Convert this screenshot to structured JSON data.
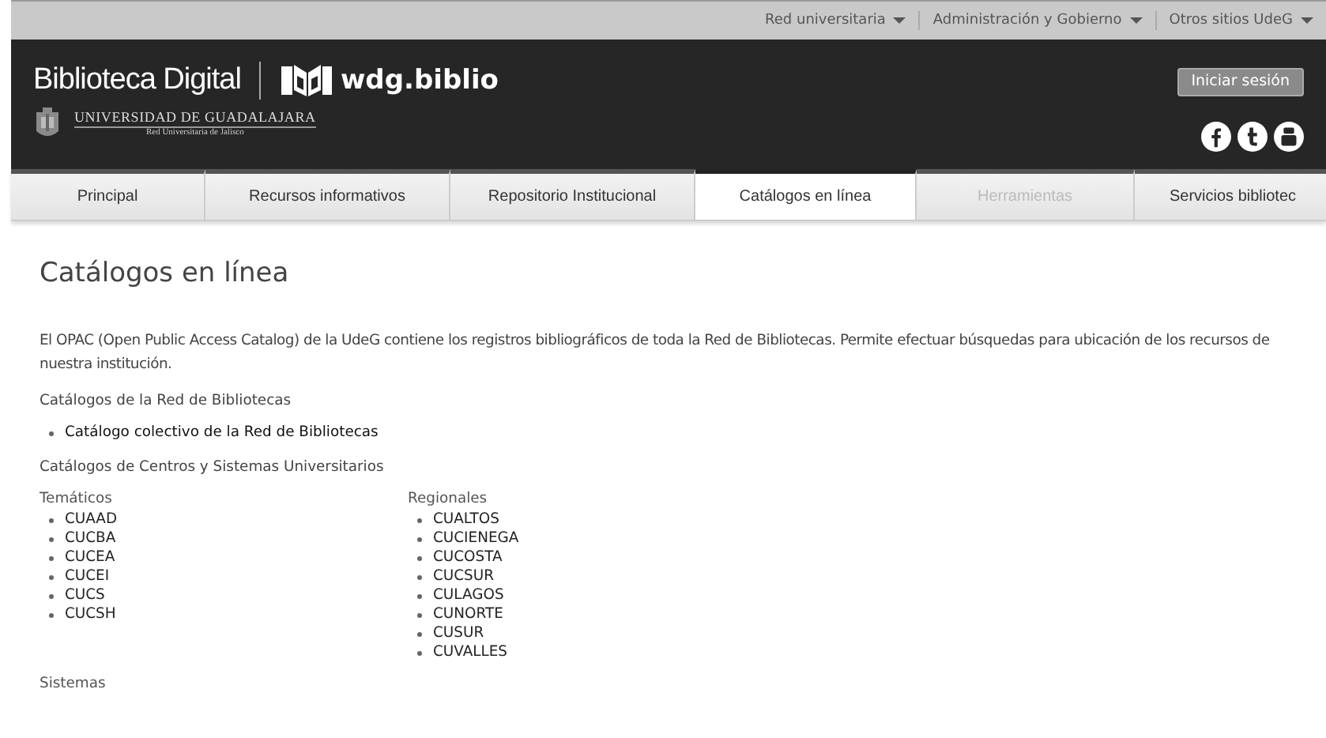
{
  "top_links": [
    {
      "label": "Red universitaria"
    },
    {
      "label": "Administración y Gobierno"
    },
    {
      "label": "Otros sitios UdeG"
    }
  ],
  "header": {
    "title": "Biblioteca Digital",
    "logo_text": "wdg.biblio",
    "university": "UNIVERSIDAD DE GUADALAJARA",
    "university_sub": "Red Universitaria de Jalisco",
    "login_button": "Iniciar sesión"
  },
  "nav": [
    {
      "label": "Principal",
      "selected": false,
      "disabled": false
    },
    {
      "label": "Recursos informativos",
      "selected": false,
      "disabled": false
    },
    {
      "label": "Repositorio Institucional",
      "selected": false,
      "disabled": false
    },
    {
      "label": "Catálogos en línea",
      "selected": true,
      "disabled": false
    },
    {
      "label": "Herramientas",
      "selected": false,
      "disabled": true
    },
    {
      "label": "Servicios bibliotec",
      "selected": false,
      "disabled": false
    }
  ],
  "page": {
    "title": "Catálogos en línea",
    "intro": "El OPAC (Open Public Access Catalog) de la UdeG contiene los registros bibliográficos de toda la Red de Bibliotecas. Permite efectuar búsquedas para ubicación de los recursos de nuestra institución.",
    "network_heading": "Catálogos de la Red de Bibliotecas",
    "network_links": [
      "Catálogo colectivo de la Red de Bibliotecas"
    ],
    "centers_heading": "Catálogos de Centros y Sistemas Universitarios",
    "groups": [
      {
        "title": "Temáticos",
        "items": [
          "CUAAD",
          "CUCBA",
          "CUCEA",
          "CUCEI",
          "CUCS",
          "CUCSH"
        ]
      },
      {
        "title": "Regionales",
        "items": [
          "CUALTOS",
          "CUCIENEGA",
          "CUCOSTA",
          "CUCSUR",
          "CULAGOS",
          "CUNORTE",
          "CUSUR",
          "CUVALLES"
        ]
      }
    ],
    "systems_heading": "Sistemas"
  }
}
